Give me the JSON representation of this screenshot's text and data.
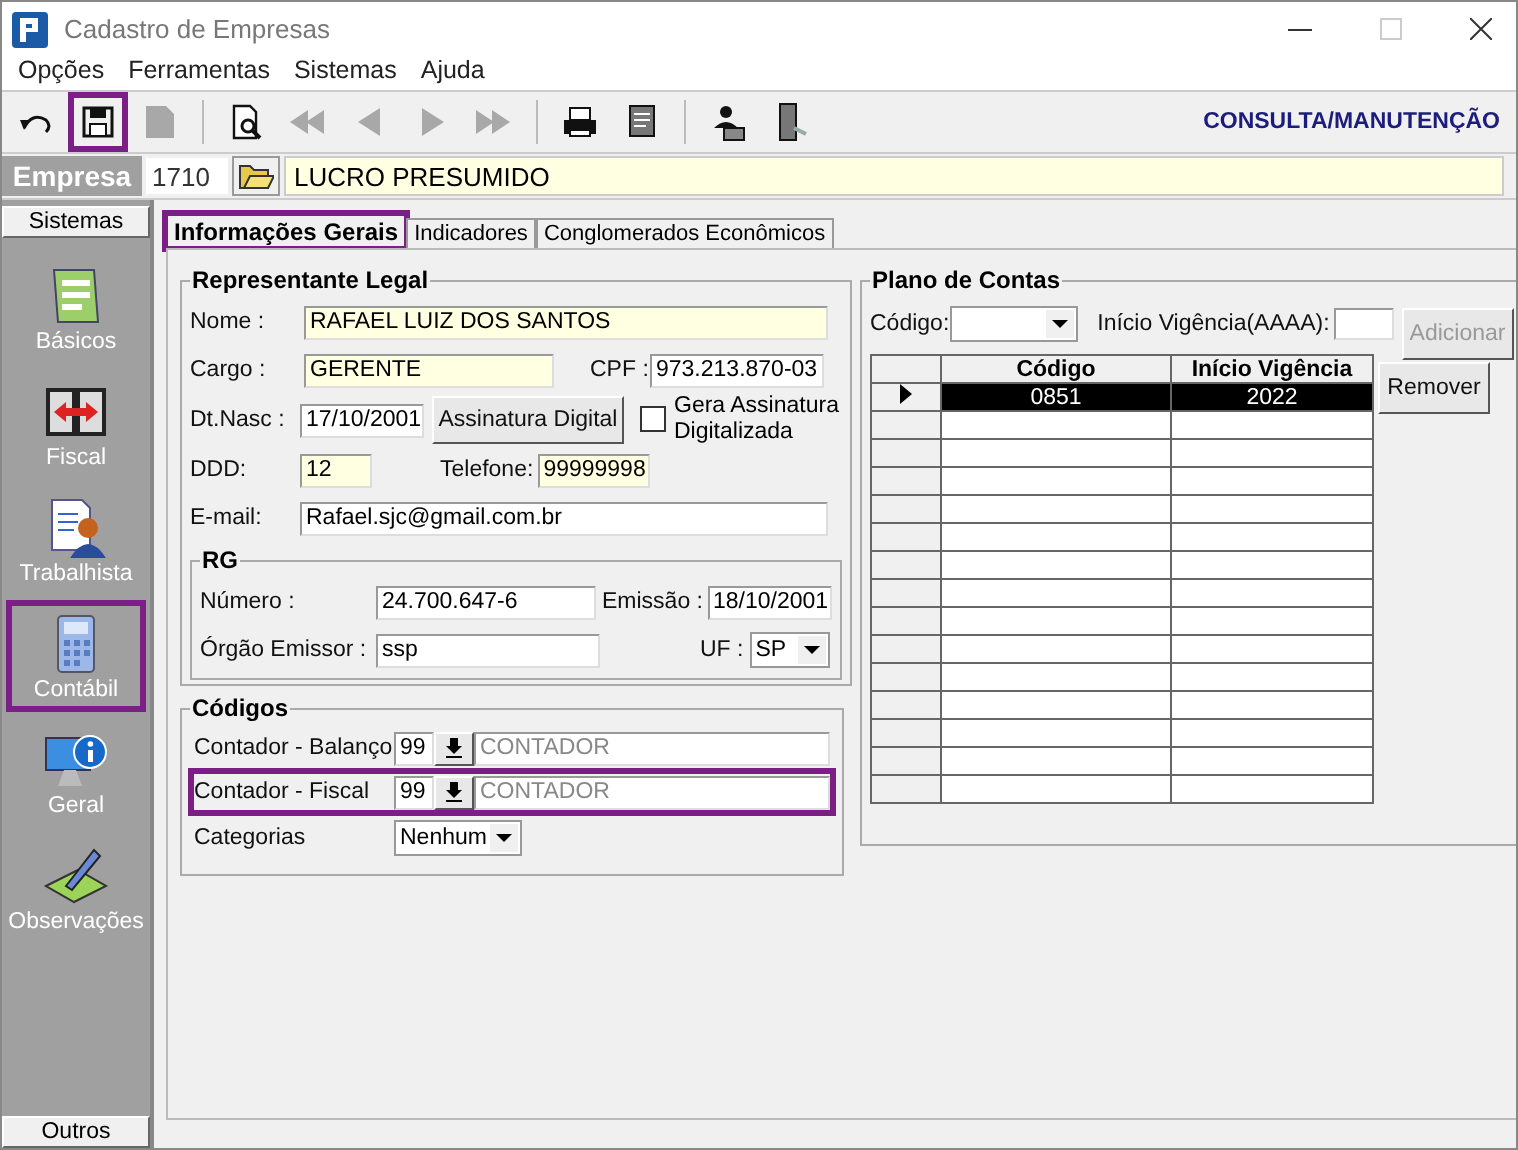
{
  "window": {
    "title": "Cadastro de Empresas"
  },
  "menu": [
    "Opções",
    "Ferramentas",
    "Sistemas",
    "Ajuda"
  ],
  "toolbar": {
    "buttons": [
      {
        "kind": "undo",
        "disabled": false,
        "highlighted": false
      },
      {
        "kind": "save",
        "disabled": false,
        "highlighted": true
      },
      {
        "kind": "document",
        "disabled": true,
        "highlighted": false
      },
      {
        "kind": "preview",
        "disabled": false,
        "highlighted": false
      },
      {
        "kind": "first",
        "disabled": true,
        "highlighted": false
      },
      {
        "kind": "prev",
        "disabled": true,
        "highlighted": false
      },
      {
        "kind": "next",
        "disabled": true,
        "highlighted": false
      },
      {
        "kind": "last",
        "disabled": true,
        "highlighted": false
      },
      {
        "kind": "print",
        "disabled": false,
        "highlighted": false
      },
      {
        "kind": "report",
        "disabled": false,
        "highlighted": false
      },
      {
        "kind": "user",
        "disabled": false,
        "highlighted": false
      },
      {
        "kind": "exit",
        "disabled": false,
        "highlighted": false
      }
    ],
    "mode": "CONSULTA/MANUTENÇÃO"
  },
  "empresa": {
    "label": "Empresa",
    "code": "1710",
    "name": "LUCRO PRESUMIDO"
  },
  "sidebar": {
    "header": "Sistemas",
    "footer": "Outros",
    "items": [
      {
        "kind": "basicos",
        "label": "Básicos",
        "highlighted": false
      },
      {
        "kind": "fiscal",
        "label": "Fiscal",
        "highlighted": false
      },
      {
        "kind": "trabalhista",
        "label": "Trabalhista",
        "highlighted": false
      },
      {
        "kind": "contabil",
        "label": "Contábil",
        "highlighted": true
      },
      {
        "kind": "geral",
        "label": "Geral",
        "highlighted": false
      },
      {
        "kind": "observacoes",
        "label": "Observações",
        "highlighted": false
      }
    ]
  },
  "tabs": [
    {
      "label": "Informações Gerais",
      "selected": true,
      "highlighted": true
    },
    {
      "label": "Indicadores",
      "selected": false,
      "highlighted": false
    },
    {
      "label": "Conglomerados Econômicos",
      "selected": false,
      "highlighted": false
    }
  ],
  "representante": {
    "title": "Representante Legal",
    "nome": {
      "label": "Nome :",
      "value": "RAFAEL LUIZ DOS SANTOS"
    },
    "cargo": {
      "label": "Cargo :",
      "value": "GERENTE"
    },
    "cpf": {
      "label": "CPF :",
      "value": "973.213.870-03"
    },
    "nascimento": {
      "label": "Dt.Nasc :",
      "value": "17/10/2001"
    },
    "assinatura_button": "Assinatura Digital",
    "gera_assinatura": {
      "label": "Gera Assinatura Digitalizada",
      "checked": false
    },
    "ddd": {
      "label": "DDD:",
      "value": "12"
    },
    "telefone": {
      "label": "Telefone:",
      "value": "99999998"
    },
    "email": {
      "label": "E-mail:",
      "value": "Rafael.sjc@gmail.com.br"
    },
    "rg": {
      "title": "RG",
      "numero": {
        "label": "Número :",
        "value": "24.700.647-6"
      },
      "emissao": {
        "label": "Emissão :",
        "value": "18/10/2001"
      },
      "orgao": {
        "label": "Órgão Emissor :",
        "value": "ssp"
      },
      "uf": {
        "label": "UF :",
        "value": "SP"
      }
    }
  },
  "codigos": {
    "title": "Códigos",
    "rows": [
      {
        "label": "Contador - Balanço",
        "code": "99",
        "name": "CONTADOR",
        "highlighted": false
      },
      {
        "label": "Contador - Fiscal",
        "code": "99",
        "name": "CONTADOR",
        "highlighted": true
      }
    ],
    "categorias": {
      "label": "Categorias",
      "value": "Nenhum"
    }
  },
  "plano": {
    "title": "Plano de Contas",
    "codigo_label": "Código:",
    "inicio_label": "Início Vigência(AAAA):",
    "buttons": [
      {
        "label": "Adicionar",
        "disabled": true
      },
      {
        "label": "Remover",
        "disabled": false
      }
    ],
    "columns": [
      "Código",
      "Início Vigência"
    ],
    "rows": [
      {
        "cells": [
          "0851",
          "2022"
        ],
        "selected": true
      }
    ]
  }
}
